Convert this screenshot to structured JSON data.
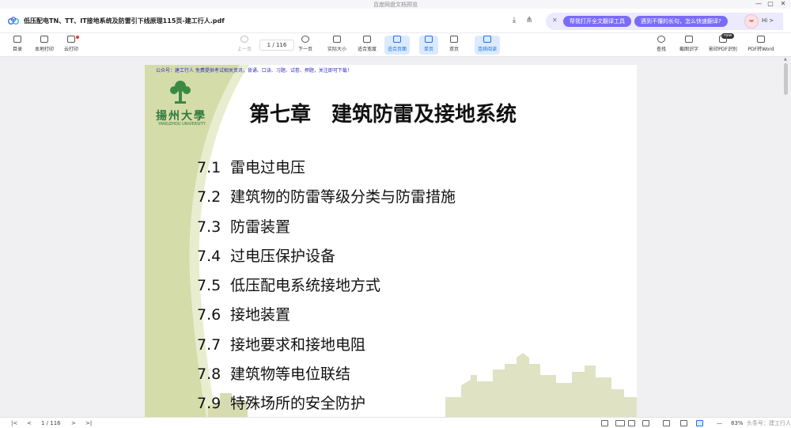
{
  "window": {
    "app_title": "百度网盘文档预览",
    "controls": [
      "—",
      "▢",
      "✕"
    ]
  },
  "document": {
    "title": "低压配电TN、TT、IT接地系统及防雷引下线原理115页-建工行人.pdf"
  },
  "assistant": {
    "close": "✕",
    "pill_1": "帮我打开全文翻译工具",
    "pill_2": "遇到不懂的长句，怎么快速翻译?",
    "greeting": "Hi >"
  },
  "toolbar": {
    "outline": "目录",
    "local_print": "本地打印",
    "cloud_print": "云打印",
    "prev_page": "上一页",
    "page_current": "1",
    "page_total": "/ 116",
    "next_page": "下一页",
    "actual_size": "实际大小",
    "fit_width": "适合宽度",
    "fit_page": "适合页面",
    "single_page": "单页",
    "double_page": "双页",
    "continuous": "连续阅读",
    "search": "查找",
    "screenshot_ocr": "截图识字",
    "pdf_scan": "影印PDF识别",
    "pdf_to_word": "PDF转Word",
    "new_badge": "new"
  },
  "page": {
    "notice": "公众号：建工行人 免费提供考试相关资讯，背诵、口诀、习题、试卷、押题，关注即可下载！",
    "university_cn": "揚州大學",
    "university_en": "YANGZHOU UNIVERSITY",
    "chapter_title": "第七章　建筑防雷及接地系统",
    "toc": [
      {
        "num": "7.1",
        "title": "雷电过电压"
      },
      {
        "num": "7.2",
        "title": "建筑物的防雷等级分类与防雷措施"
      },
      {
        "num": "7.3",
        "title": "防雷装置"
      },
      {
        "num": "7.4",
        "title": "过电压保护设备"
      },
      {
        "num": "7.5",
        "title": "低压配电系统接地方式"
      },
      {
        "num": "7.6",
        "title": "接地装置"
      },
      {
        "num": "7.7",
        "title": "接地要求和接地电阻"
      },
      {
        "num": "7.8",
        "title": "建筑物等电位联结"
      },
      {
        "num": "7.9",
        "title": "特殊场所的安全防护"
      }
    ]
  },
  "statusbar": {
    "page_indicator": "1 / 116",
    "zoom": "83%",
    "watermark": "头条号：建工行人"
  },
  "colors": {
    "accent": "#1a73e8",
    "assistant_purple": "#7b6cf6",
    "page_green": "#cfd8a3",
    "logo_green": "#2f7a3a"
  }
}
